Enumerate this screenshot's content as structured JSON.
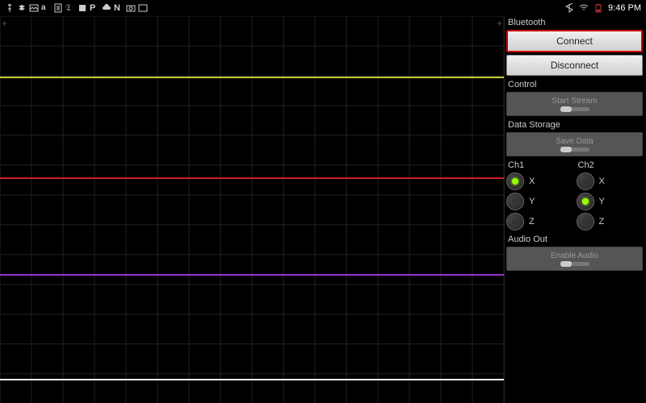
{
  "statusbar": {
    "time": "9:46 PM",
    "icons_left": [
      "usb",
      "dropbox",
      "picture",
      "amazon",
      "doc",
      "nyt",
      "app",
      "pandora",
      "cloud",
      "netflix",
      "camera",
      "gallery"
    ],
    "icons_right": [
      "bluetooth",
      "wifi",
      "battery"
    ]
  },
  "chart_data": {
    "type": "line",
    "title": "",
    "xlabel": "",
    "ylabel": "",
    "xlim": [
      0,
      100
    ],
    "ylim": [
      0,
      480
    ],
    "series": [
      {
        "name": "trace-yellow",
        "color": "#cccc33",
        "y": 75
      },
      {
        "name": "trace-red",
        "color": "#cc2222",
        "y": 200
      },
      {
        "name": "trace-purple",
        "color": "#9933cc",
        "y": 320
      },
      {
        "name": "trace-white",
        "color": "#eeeeee",
        "y": 450
      }
    ],
    "grid": {
      "x_divisions": 16,
      "y_divisions": 13
    }
  },
  "panel": {
    "bluetooth": {
      "label": "Bluetooth",
      "connect": "Connect",
      "disconnect": "Disconnect"
    },
    "control": {
      "label": "Control",
      "start": "Start Stream"
    },
    "storage": {
      "label": "Data Storage",
      "save": "Save Data"
    },
    "channels": {
      "ch1": {
        "label": "Ch1",
        "axes": [
          "X",
          "Y",
          "Z"
        ],
        "active": "X"
      },
      "ch2": {
        "label": "Ch2",
        "axes": [
          "X",
          "Y",
          "Z"
        ],
        "active": "Y"
      }
    },
    "audio": {
      "label": "Audio Out",
      "enable": "Enable Audio"
    }
  }
}
